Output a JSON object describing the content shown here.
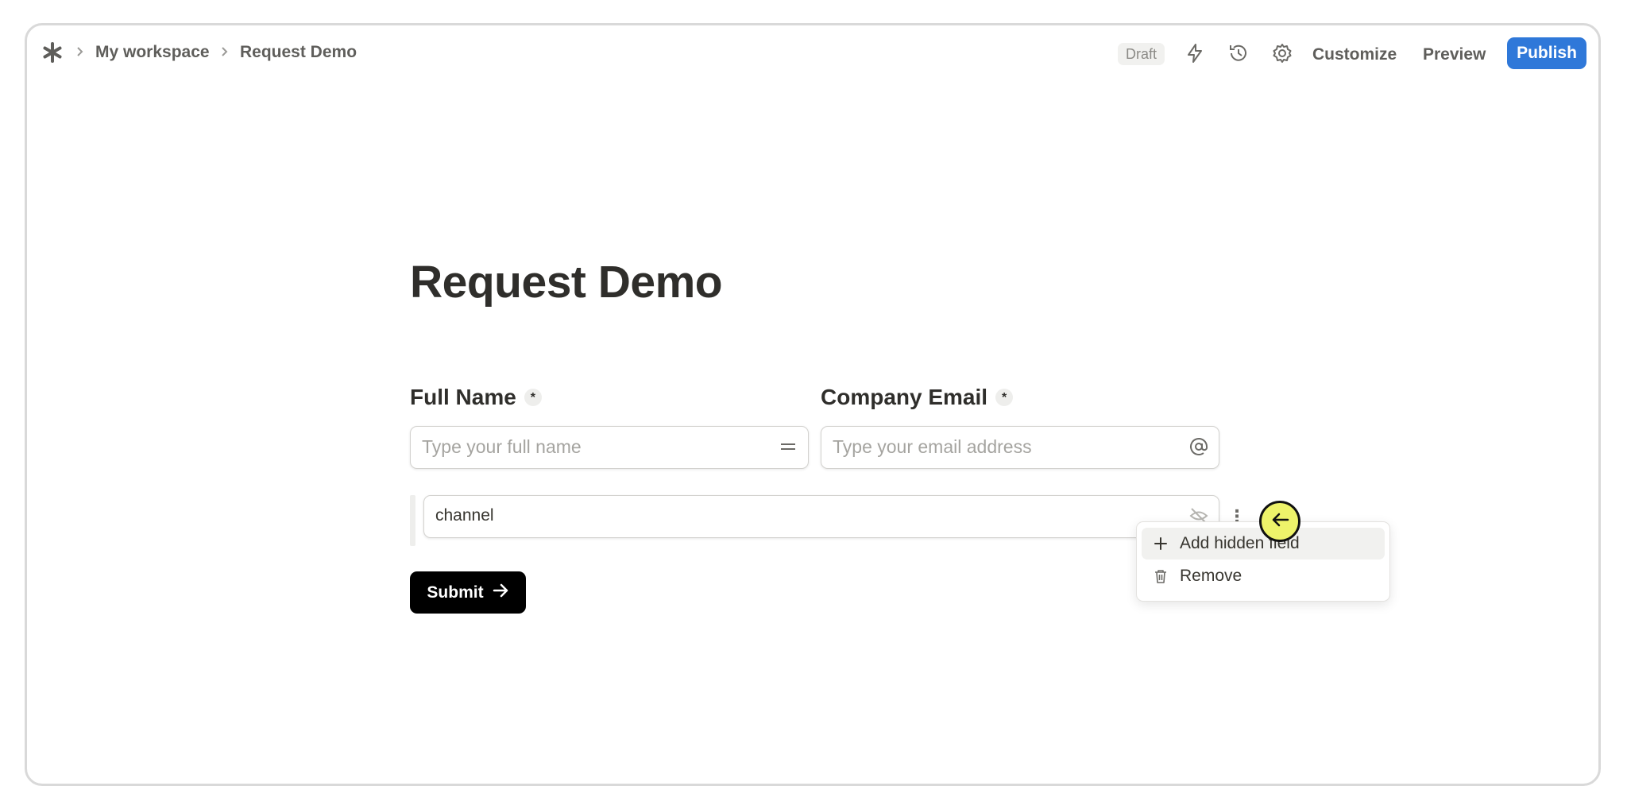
{
  "breadcrumb": {
    "workspace": "My workspace",
    "page": "Request Demo"
  },
  "header": {
    "status_badge": "Draft",
    "icons": [
      "lightning-icon",
      "history-icon",
      "settings-icon"
    ],
    "customize_label": "Customize",
    "preview_label": "Preview",
    "publish_label": "Publish"
  },
  "form": {
    "title": "Request Demo",
    "fields": [
      {
        "label": "Full Name",
        "required_mark": "*",
        "placeholder": "Type your full name",
        "icon": "short-text-icon"
      },
      {
        "label": "Company Email",
        "required_mark": "*",
        "placeholder": "Type your email address",
        "icon": "at-sign-icon"
      }
    ],
    "hidden_field": {
      "value": "channel",
      "icon": "eye-off-icon"
    },
    "submit_label": "Submit"
  },
  "menu": {
    "items": [
      {
        "label": "Add hidden field",
        "icon": "plus-icon"
      },
      {
        "label": "Remove",
        "icon": "trash-icon"
      }
    ]
  },
  "colors": {
    "publish_bg": "#2f78d9",
    "submit_bg": "#000000",
    "cursor_highlight": "#eef36a"
  }
}
